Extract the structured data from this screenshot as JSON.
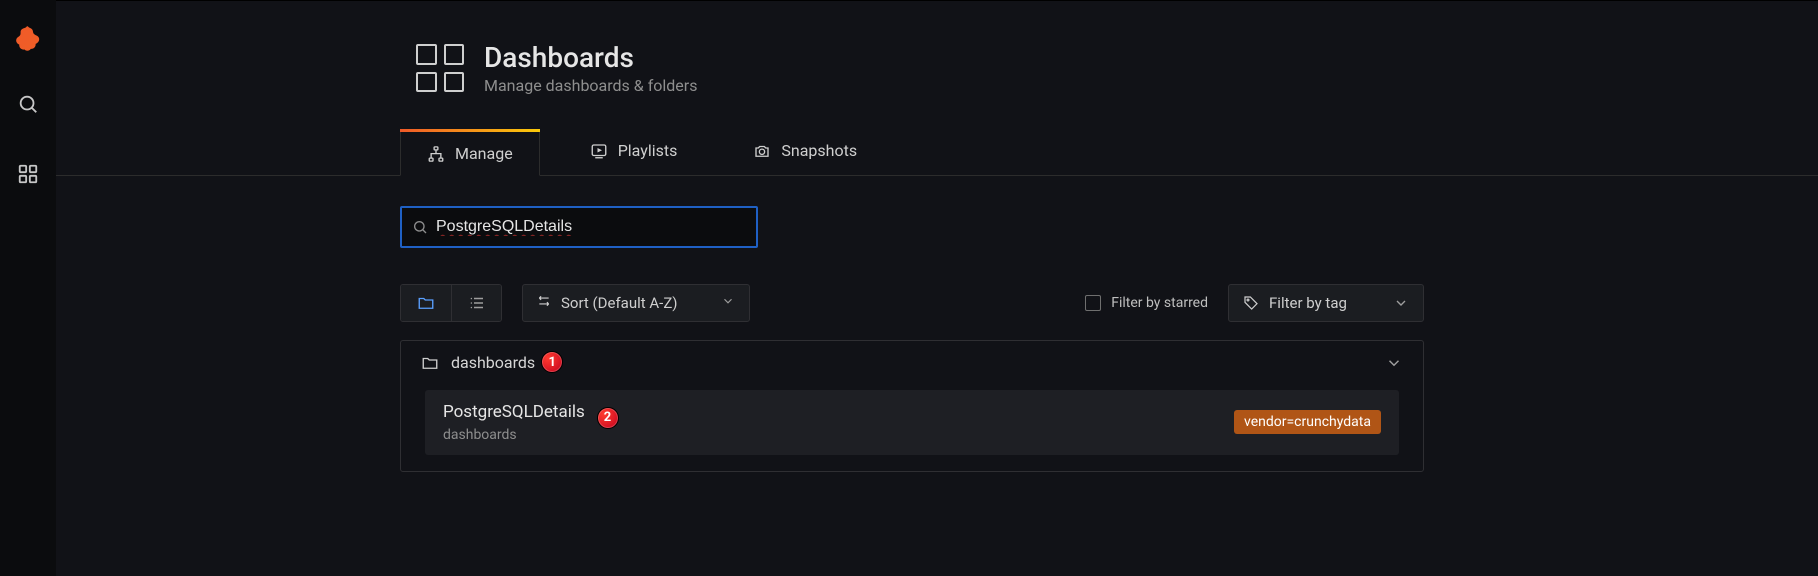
{
  "sidebar": {
    "logo_name": "grafana-logo",
    "items": [
      {
        "name": "search-icon"
      },
      {
        "name": "dashboards-grid-icon"
      }
    ]
  },
  "header": {
    "title": "Dashboards",
    "subtitle": "Manage dashboards & folders"
  },
  "tabs": [
    {
      "label": "Manage",
      "icon": "sitemap-icon",
      "active": true
    },
    {
      "label": "Playlists",
      "icon": "playlist-icon",
      "active": false
    },
    {
      "label": "Snapshots",
      "icon": "camera-icon",
      "active": false
    }
  ],
  "search": {
    "value": "PostgreSQLDetails",
    "placeholder": "Search dashboards"
  },
  "toolbar": {
    "view_folder_active": true,
    "sort_label": "Sort (Default A-Z)",
    "filter_starred_label": "Filter by starred",
    "filter_tag_label": "Filter by tag"
  },
  "results": {
    "folder_name": "dashboards",
    "items": [
      {
        "title": "PostgreSQLDetails",
        "folder": "dashboards",
        "tag": "vendor=crunchydata"
      }
    ]
  },
  "annotations": {
    "a1": "1",
    "a2": "2"
  }
}
